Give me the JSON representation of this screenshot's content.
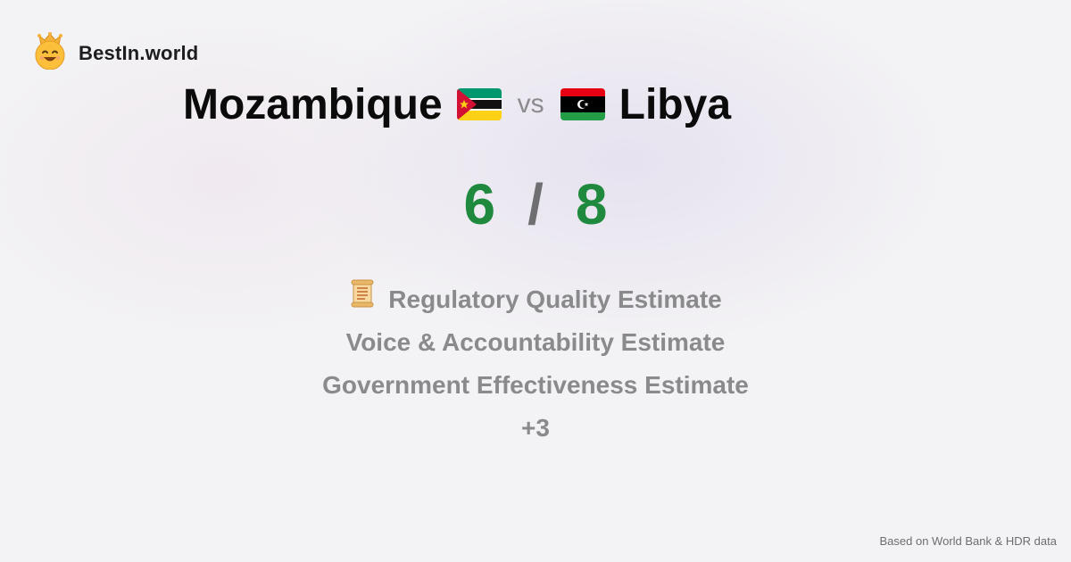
{
  "brand": {
    "name": "BestIn.world",
    "logo_icon": "smiling-crown-face-icon"
  },
  "comparison": {
    "country_a": "Mozambique",
    "country_b": "Libya",
    "vs_label": "vs",
    "flag_a_icon": "mozambique-flag-icon",
    "flag_b_icon": "libya-flag-icon"
  },
  "score": {
    "a": "6",
    "separator": "/",
    "b": "8",
    "color": "#1f8a3d"
  },
  "metrics": [
    {
      "label": "Regulatory Quality Estimate",
      "icon": "scroll-icon"
    },
    {
      "label": "Voice & Accountability Estimate"
    },
    {
      "label": "Government Effectiveness Estimate"
    },
    {
      "label": "+3"
    }
  ],
  "footer": {
    "source": "Based on World Bank & HDR data"
  }
}
